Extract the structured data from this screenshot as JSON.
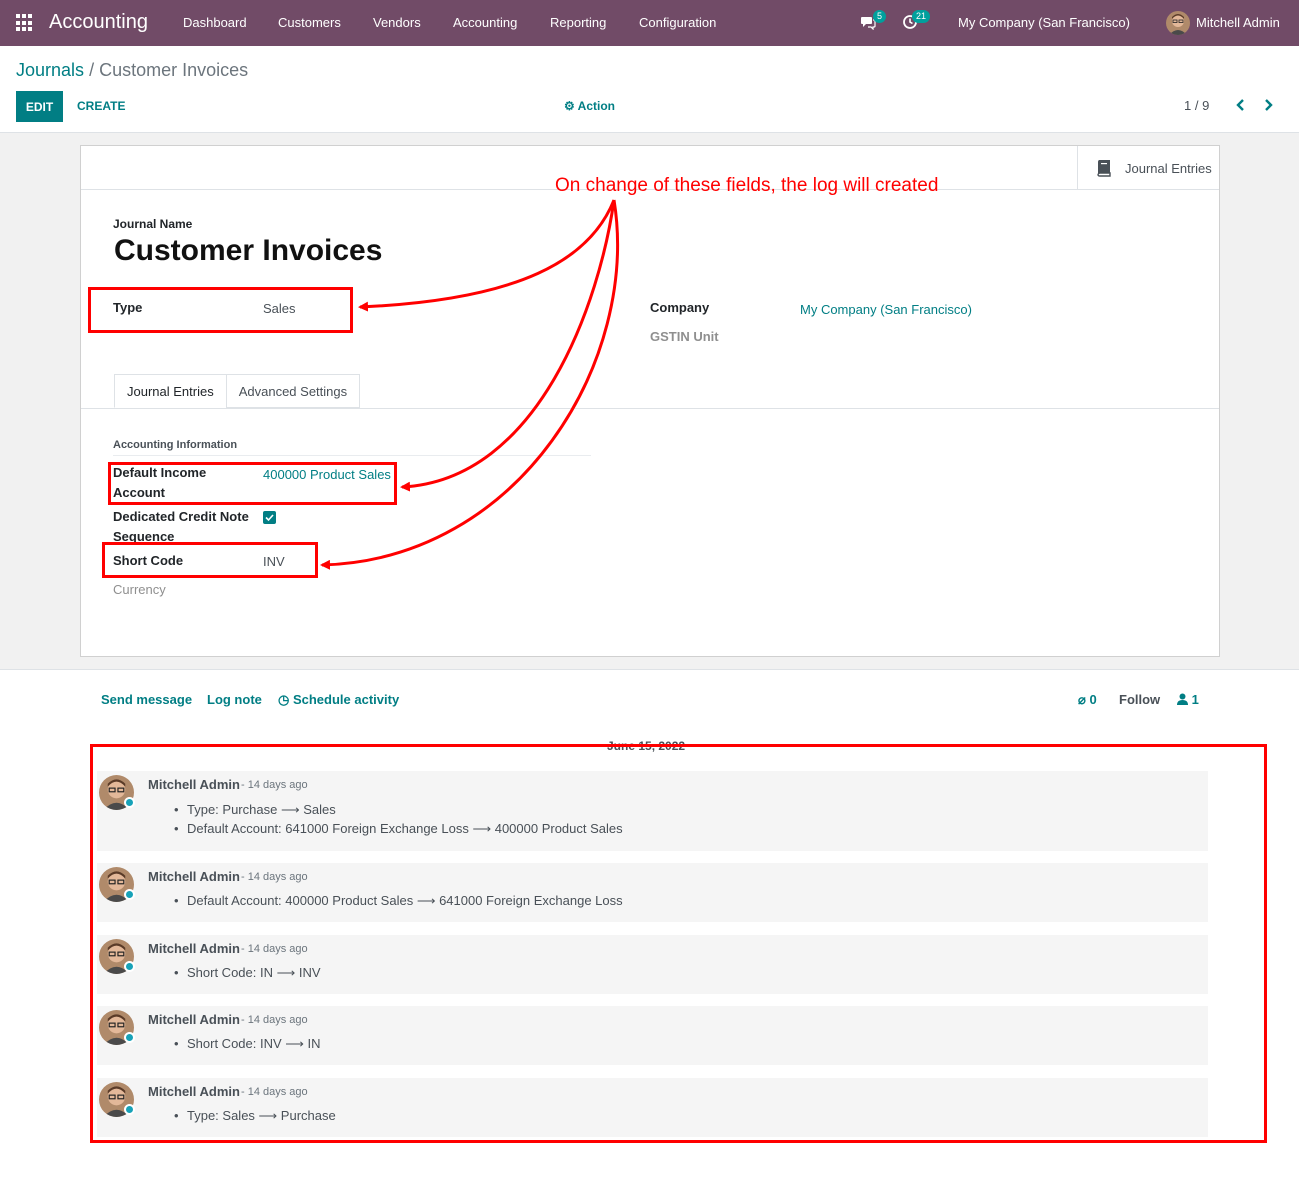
{
  "navbar": {
    "app_name": "Accounting",
    "menu": [
      "Dashboard",
      "Customers",
      "Vendors",
      "Accounting",
      "Reporting",
      "Configuration"
    ],
    "messages_count": "5",
    "activities_count": "21",
    "company": "My Company (San Francisco)",
    "user": "Mitchell Admin"
  },
  "control_panel": {
    "breadcrumb_parent": "Journals",
    "breadcrumb_sep": "/",
    "breadcrumb_current": "Customer Invoices",
    "edit_label": "EDIT",
    "create_label": "CREATE",
    "action_label": "Action",
    "pager": "1 / 9"
  },
  "form": {
    "smart_button_label": "Journal Entries",
    "name_label": "Journal Name",
    "name": "Customer Invoices",
    "type_label": "Type",
    "type_value": "Sales",
    "company_label": "Company",
    "company_value": "My Company (San Francisco)",
    "gstin_label": "GSTIN Unit",
    "tabs": [
      "Journal Entries",
      "Advanced Settings"
    ],
    "group_title": "Accounting Information",
    "income_account_label_1": "Default Income",
    "income_account_label_2": "Account",
    "income_account_value": "400000 Product Sales",
    "credit_note_label_1": "Dedicated Credit Note",
    "credit_note_label_2": "Sequence",
    "credit_note_checked": true,
    "short_code_label": "Short Code",
    "short_code_value": "INV",
    "currency_label": "Currency"
  },
  "chatter": {
    "send_message": "Send message",
    "log_note": "Log note",
    "schedule_activity": "Schedule activity",
    "attachments": "0",
    "follow": "Follow",
    "followers": "1",
    "date_separator": "June 15, 2022",
    "messages": [
      {
        "author": "Mitchell Admin",
        "date": "- 14 days ago",
        "lines": [
          "Type: Purchase ⟶ Sales",
          "Default Account: 641000 Foreign Exchange Loss ⟶ 400000 Product Sales"
        ]
      },
      {
        "author": "Mitchell Admin",
        "date": "- 14 days ago",
        "lines": [
          "Default Account: 400000 Product Sales ⟶ 641000 Foreign Exchange Loss"
        ]
      },
      {
        "author": "Mitchell Admin",
        "date": "- 14 days ago",
        "lines": [
          "Short Code: IN ⟶ INV"
        ]
      },
      {
        "author": "Mitchell Admin",
        "date": "- 14 days ago",
        "lines": [
          "Short Code: INV ⟶ IN"
        ]
      },
      {
        "author": "Mitchell Admin",
        "date": "- 14 days ago",
        "lines": [
          "Type: Sales ⟶ Purchase"
        ]
      }
    ]
  },
  "annotation": {
    "text": "On change of these fields, the log will created",
    "color": "#ff0000"
  },
  "colors": {
    "navbar": "#714b67",
    "primary": "#017e84"
  }
}
